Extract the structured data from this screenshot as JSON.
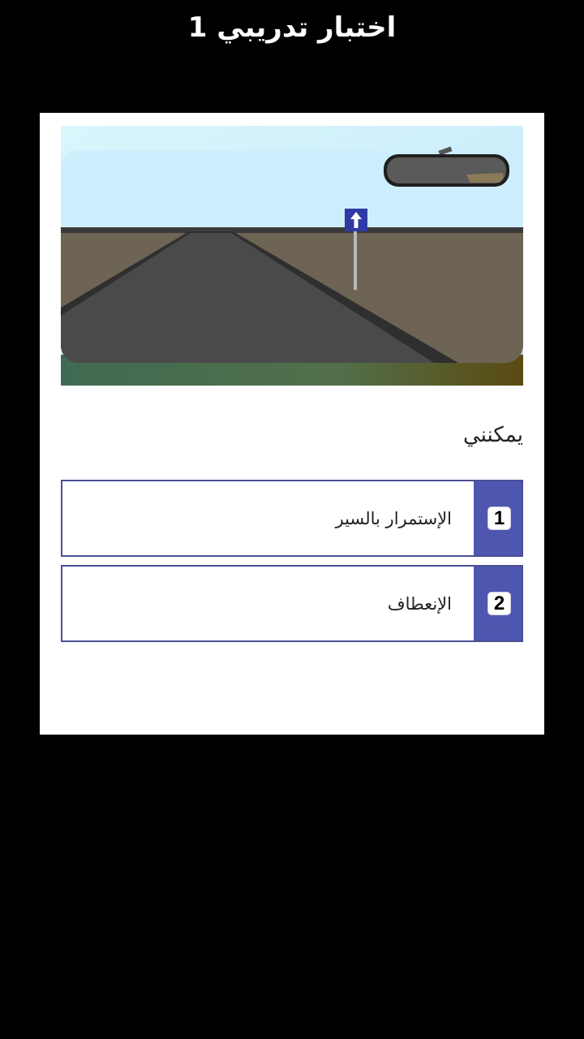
{
  "header": {
    "title": "اختبار تدريبي 1"
  },
  "question": {
    "text": "يمكنني"
  },
  "scene": {
    "description_icon": "road-with-one-way-sign",
    "sign_icon": "arrow-up-icon",
    "colors": {
      "sky": "#cdeefc",
      "ground": "#6e6456",
      "road": "#4a4a4a",
      "sign": "#2e3aa3"
    }
  },
  "answers": [
    {
      "number": "1",
      "label": "الإستمرار بالسير"
    },
    {
      "number": "2",
      "label": "الإنعطاف"
    }
  ],
  "colors": {
    "accent": "#4f56b0",
    "border": "#4b4f96",
    "background": "#000000",
    "card": "#ffffff"
  }
}
